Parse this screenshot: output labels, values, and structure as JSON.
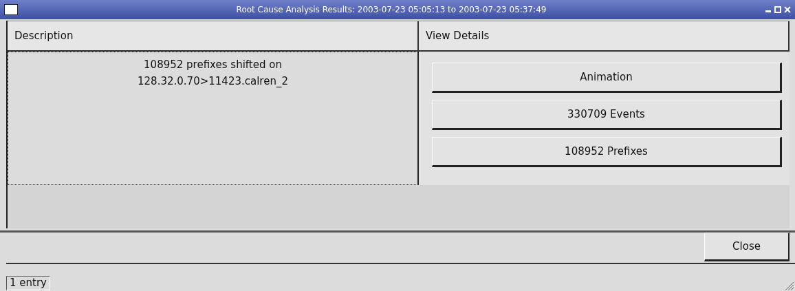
{
  "window": {
    "title": "Root Cause Analysis Results: 2003-07-23 05:05:13 to 2003-07-23 05:37:49"
  },
  "table": {
    "columns": [
      "Description",
      "View Details"
    ],
    "rows": [
      {
        "description": [
          "108952 prefixes shifted on",
          "128.32.0.70>11423.calren_2"
        ],
        "buttons": [
          "Animation",
          "330709 Events",
          "108952 Prefixes"
        ]
      }
    ]
  },
  "buttons": [
    "Close"
  ],
  "status_bar": {
    "text": "1 entry"
  }
}
